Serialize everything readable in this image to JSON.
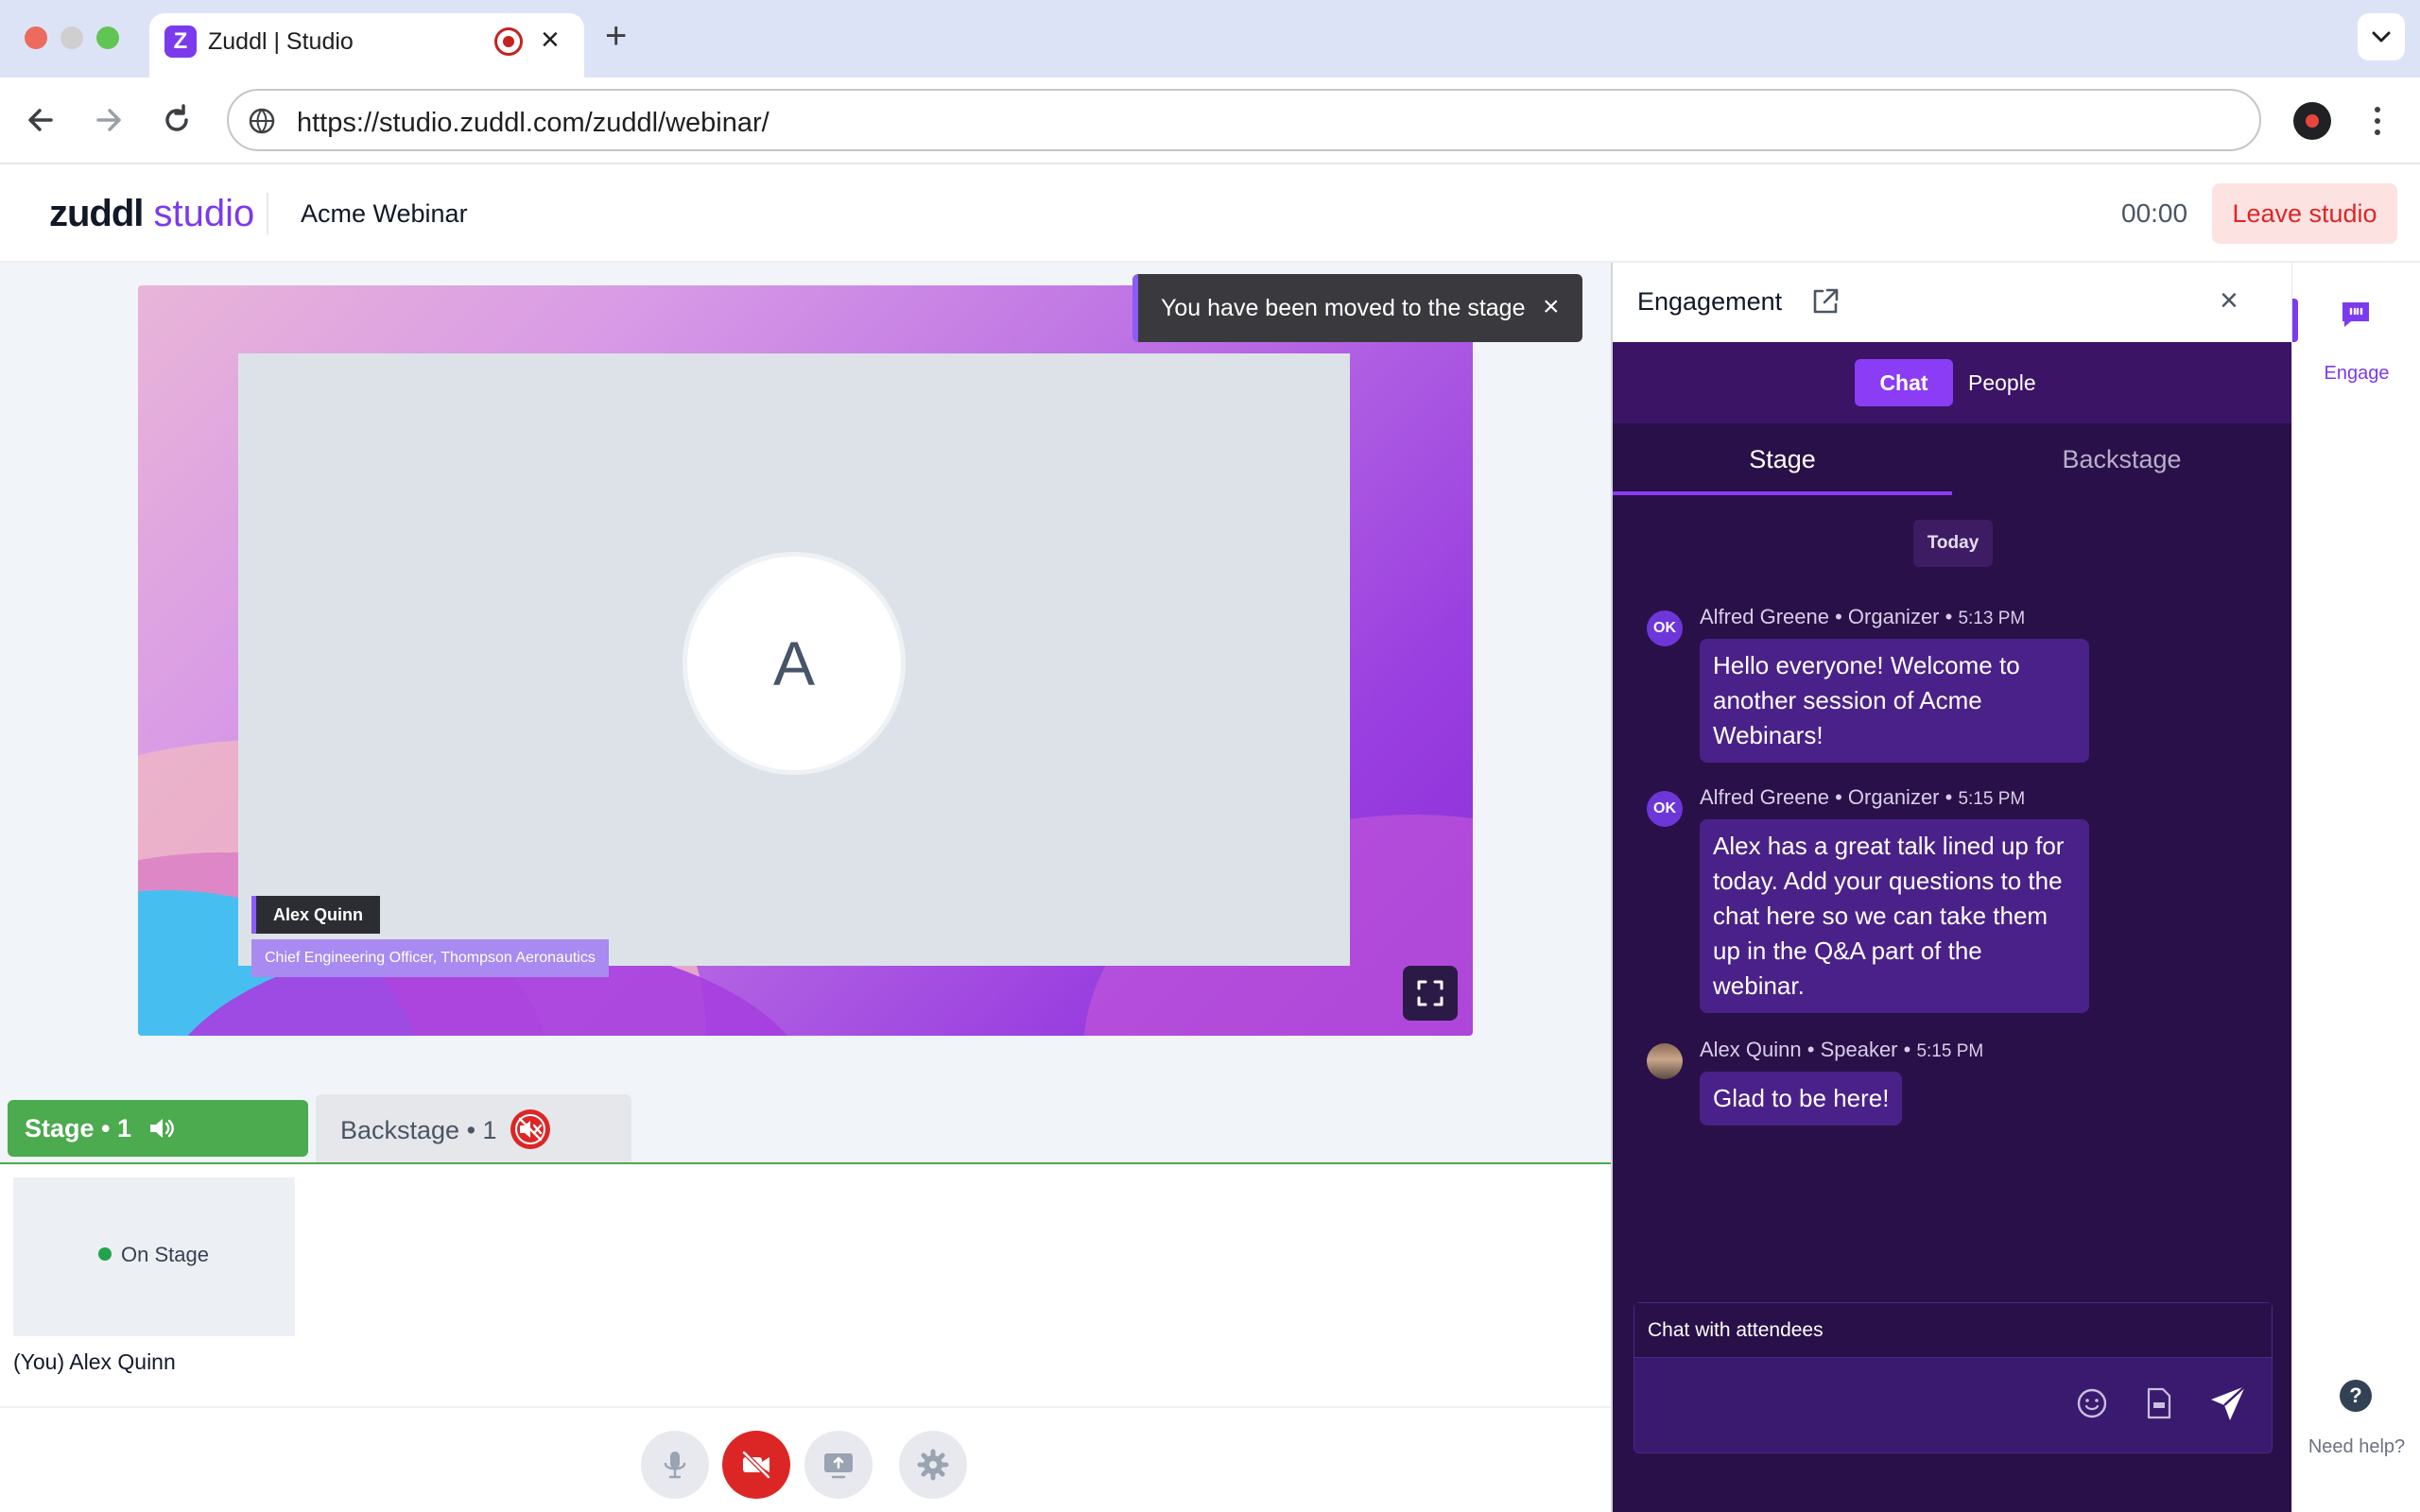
{
  "browser": {
    "tab_title": "Zuddl | Studio",
    "favicon_letter": "Z",
    "url": "https://studio.zuddl.com/zuddl/webinar/"
  },
  "header": {
    "logo_bold": "zuddl",
    "logo_light": " studio",
    "event_title": "Acme Webinar",
    "timer": "00:00",
    "leave_label": "Leave studio"
  },
  "stage": {
    "avatar_letter": "A",
    "speaker_name": "Alex Quinn",
    "speaker_role": "Chief Engineering Officer, Thompson Aeronautics",
    "toast": "You have been moved to the stage",
    "tabs": {
      "stage_label": "Stage • 1",
      "backstage_label": "Backstage • 1"
    },
    "participant": {
      "status": "On Stage",
      "name": "(You) Alex Quinn"
    }
  },
  "engagement": {
    "title": "Engagement",
    "toggle": {
      "chat": "Chat",
      "people": "People"
    },
    "subtabs": {
      "stage": "Stage",
      "backstage": "Backstage"
    },
    "day_label": "Today",
    "messages": [
      {
        "initials": "OK",
        "author": "Alfred Greene",
        "role": "Organizer",
        "time": "5:13 PM",
        "text": "Hello everyone! Welcome to another session of Acme Webinars!"
      },
      {
        "initials": "OK",
        "author": "Alfred Greene",
        "role": "Organizer",
        "time": "5:15 PM",
        "text": "Alex has a great talk lined up for today. Add your questions to the chat here so we can take them up in the Q&A part of the webinar."
      },
      {
        "initials": "",
        "author": "Alex Quinn",
        "role": "Speaker",
        "time": "5:15 PM",
        "text": "Glad to be here!"
      }
    ],
    "input_placeholder": "Chat with attendees"
  },
  "rail": {
    "engage_label": "Engage",
    "help_label": "Need help?"
  },
  "colors": {
    "brand": "#7c3aed",
    "stage_green": "#4caa4f",
    "danger": "#dc2626",
    "chat_bg": "#2a1048"
  }
}
